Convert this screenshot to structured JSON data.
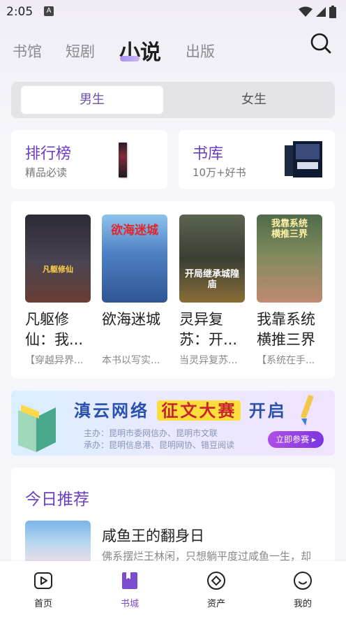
{
  "status_bar": {
    "time": "2:05",
    "notification_badge": "A"
  },
  "top_tabs": [
    {
      "label": "书馆",
      "active": false
    },
    {
      "label": "短剧",
      "active": false
    },
    {
      "label": "小说",
      "active": true
    },
    {
      "label": "出版",
      "active": false
    }
  ],
  "gender_tabs": [
    {
      "label": "男生",
      "active": true
    },
    {
      "label": "女生",
      "active": false
    }
  ],
  "entries": {
    "rank": {
      "title": "排行榜",
      "subtitle": "精品必读"
    },
    "library": {
      "title": "书库",
      "subtitle": "10万+好书"
    }
  },
  "books": [
    {
      "title": "凡躯修仙：我...",
      "desc": "【穿越异界...",
      "cover_colors": [
        "#2c2a35",
        "#5b4a55"
      ],
      "cover_text": "凡躯修仙"
    },
    {
      "title": "欲海迷城",
      "desc": "本书以写实...",
      "cover_colors": [
        "#4d7fc2",
        "#7fb2e0"
      ],
      "cover_text": "欲海迷城"
    },
    {
      "title": "灵异复苏：开...",
      "desc": "当灵异复苏...",
      "cover_colors": [
        "#3a3f35",
        "#8a6d36"
      ],
      "cover_text": "开局继承城隍庙"
    },
    {
      "title": "我靠系统横推三界",
      "desc": "【系统在手...",
      "cover_colors": [
        "#5d6a4a",
        "#b57b6a"
      ],
      "cover_text": "我靠系统横推三界"
    }
  ],
  "banner": {
    "title_left": "滇云网络",
    "title_highlight": "征文大赛",
    "title_right": "开启",
    "organizer": "主办：昆明市委网信办、昆明市文联",
    "co_organizer": "承办：昆明信息港、昆明网协、错豆阅读",
    "button": "立即参赛"
  },
  "recommend": {
    "title": "今日推荐",
    "book_title": "咸鱼王的翻身日",
    "book_desc": "佛系摆烂王林闲，只想躺平度过咸鱼一生，却"
  },
  "bottom_nav": [
    {
      "label": "首页",
      "icon": "play-icon",
      "active": false
    },
    {
      "label": "书城",
      "icon": "bookmark-icon",
      "active": true
    },
    {
      "label": "资产",
      "icon": "asset-icon",
      "active": false
    },
    {
      "label": "我的",
      "icon": "smile-icon",
      "active": false
    }
  ],
  "accent_color": "#7b4cd0"
}
